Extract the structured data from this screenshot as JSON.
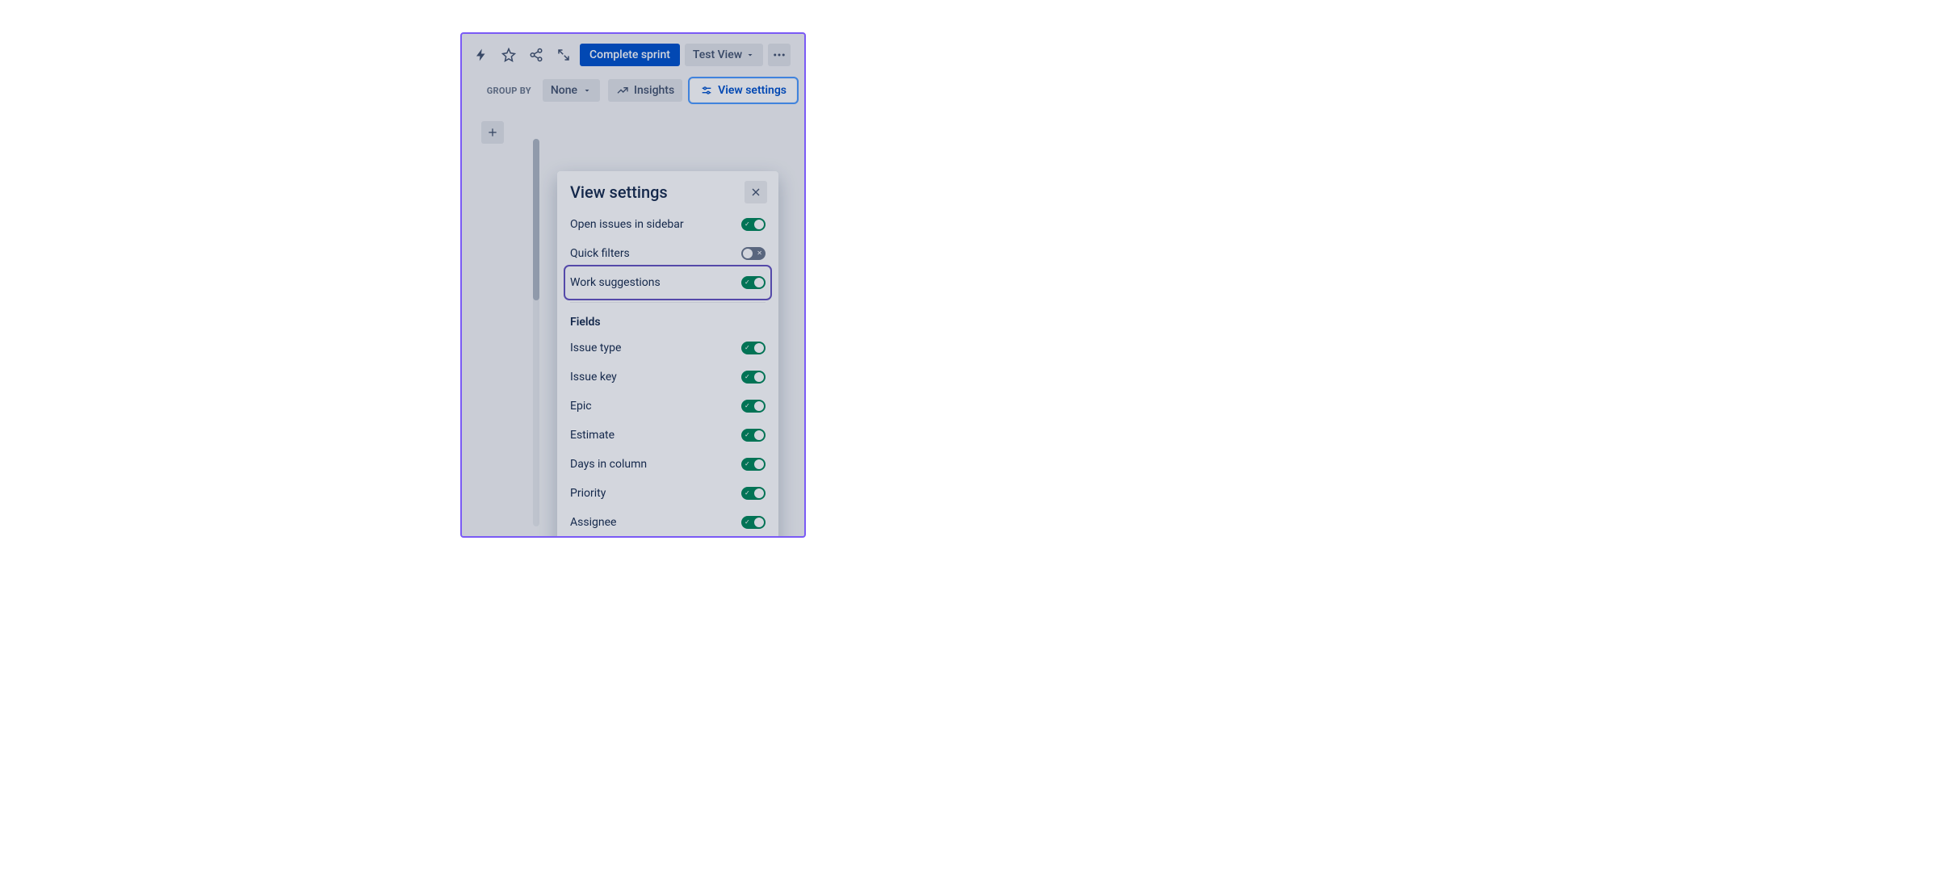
{
  "toolbar": {
    "complete_sprint_label": "Complete sprint",
    "view_dropdown_label": "Test View"
  },
  "subbar": {
    "group_by_label": "GROUP BY",
    "group_by_value": "None",
    "insights_label": "Insights",
    "view_settings_label": "View settings"
  },
  "panel": {
    "title": "View settings",
    "fields_label": "Fields",
    "settings": [
      {
        "label": "Open issues in sidebar",
        "on": true,
        "highlighted": false
      },
      {
        "label": "Quick filters",
        "on": false,
        "highlighted": false
      },
      {
        "label": "Work suggestions",
        "on": true,
        "highlighted": true
      }
    ],
    "fields": [
      {
        "label": "Issue type",
        "on": true
      },
      {
        "label": "Issue key",
        "on": true
      },
      {
        "label": "Epic",
        "on": true
      },
      {
        "label": "Estimate",
        "on": true
      },
      {
        "label": "Days in column",
        "on": true
      },
      {
        "label": "Priority",
        "on": true
      },
      {
        "label": "Assignee",
        "on": true
      }
    ]
  }
}
